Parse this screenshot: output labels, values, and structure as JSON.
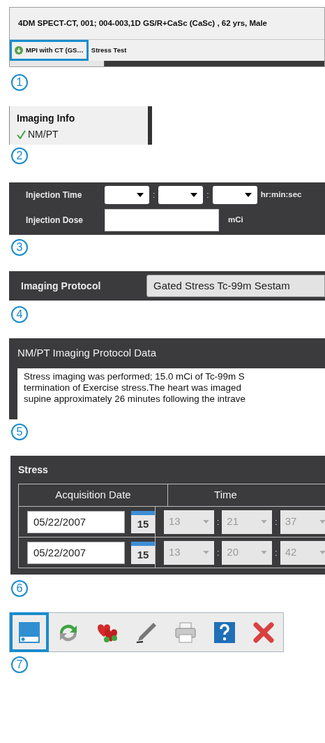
{
  "header": {
    "title": "4DM SPECT-CT, 001; 004-003,1D GS/R+CaSc (CaSc) , 62 yrs, Male",
    "tabs": [
      {
        "label": "MPI with CT (GS…",
        "highlighted": true,
        "has_icon": true
      },
      {
        "label": "Stress Test",
        "highlighted": false,
        "has_icon": false
      }
    ],
    "callout": "1"
  },
  "imaging_info": {
    "heading": "Imaging Info",
    "items": [
      {
        "label": "NM/PT",
        "checked": true
      }
    ],
    "callout": "2"
  },
  "injection": {
    "time_label": "Injection Time",
    "time_separators": [
      ":",
      ":"
    ],
    "time_unit": "hr:min:sec",
    "dose_label": "Injection Dose",
    "dose_unit": "mCi",
    "callout": "3"
  },
  "protocol": {
    "label": "Imaging Protocol",
    "value": "Gated Stress Tc-99m Sestam",
    "callout": "4"
  },
  "protocol_data": {
    "title": "NM/PT Imaging Protocol Data",
    "lines": [
      "Stress imaging was performed; 15.0 mCi of Tc-99m S",
      "termination of Exercise stress.The heart was imaged",
      "supine approximately 26 minutes following the intrave"
    ],
    "callout": "5"
  },
  "stress": {
    "title": "Stress",
    "columns": [
      "Acquisition Date",
      "Time"
    ],
    "rows": [
      {
        "date": "05/22/2007",
        "calendar_day": "15",
        "time": [
          {
            "value": "13",
            "separator": ":",
            "disabled": true
          },
          {
            "value": "21",
            "separator": ":",
            "disabled": true
          },
          {
            "value": "37",
            "disabled": true
          }
        ]
      },
      {
        "date": "05/22/2007",
        "calendar_day": "15",
        "time": [
          {
            "value": "13",
            "separator": ":",
            "disabled": true
          },
          {
            "value": "20",
            "separator": ":",
            "disabled": true
          },
          {
            "value": "42",
            "disabled": true
          }
        ]
      }
    ],
    "callout": "6"
  },
  "toolbar": {
    "items": [
      {
        "kind": "panel",
        "highlighted": true
      },
      {
        "kind": "refresh",
        "highlighted": false
      },
      {
        "kind": "hearts",
        "highlighted": false
      },
      {
        "kind": "pen",
        "highlighted": false
      },
      {
        "kind": "printer",
        "highlighted": false
      },
      {
        "kind": "help",
        "highlighted": false
      },
      {
        "kind": "close",
        "highlighted": false
      }
    ],
    "callout": "7"
  }
}
